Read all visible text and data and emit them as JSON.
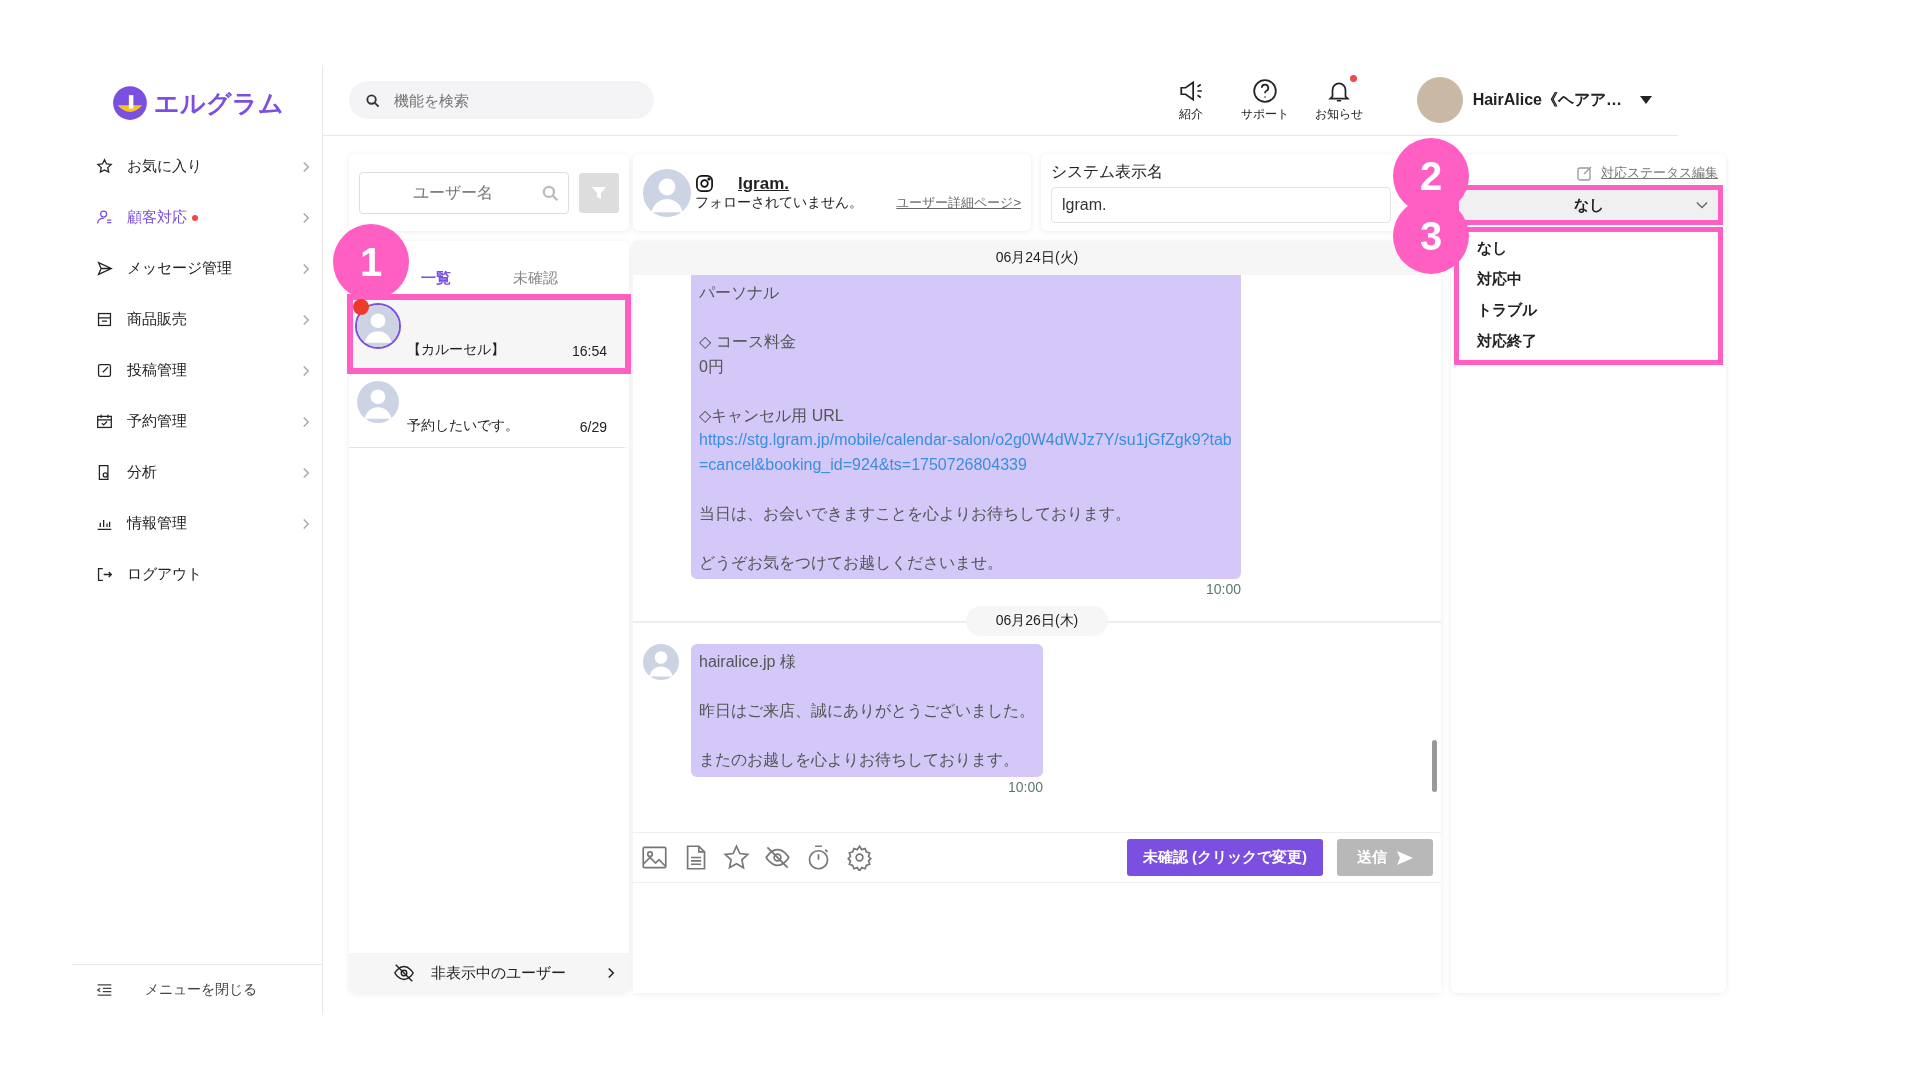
{
  "logo": {
    "text": "エルグラム"
  },
  "sidebar": {
    "items": [
      {
        "label": "お気に入り",
        "selected": false,
        "notification": false,
        "has_submenu": true
      },
      {
        "label": "顧客対応",
        "selected": true,
        "notification": true,
        "has_submenu": true
      },
      {
        "label": "メッセージ管理",
        "selected": false,
        "notification": false,
        "has_submenu": true
      },
      {
        "label": "商品販売",
        "selected": false,
        "notification": false,
        "has_submenu": true
      },
      {
        "label": "投稿管理",
        "selected": false,
        "notification": false,
        "has_submenu": true
      },
      {
        "label": "予約管理",
        "selected": false,
        "notification": false,
        "has_submenu": true
      },
      {
        "label": "分析",
        "selected": false,
        "notification": false,
        "has_submenu": true
      },
      {
        "label": "情報管理",
        "selected": false,
        "notification": false,
        "has_submenu": true
      },
      {
        "label": "ログアウト",
        "selected": false,
        "notification": false,
        "has_submenu": false
      }
    ],
    "collapse_label": "メニューを閉じる"
  },
  "header": {
    "search": {
      "placeholder": "機能を検索"
    },
    "nav": [
      {
        "label": "紹介",
        "notification": false
      },
      {
        "label": "サポート",
        "notification": false
      },
      {
        "label": "お知らせ",
        "notification": true
      }
    ],
    "user": {
      "name": "HairAlice《ヘアア…"
    }
  },
  "user_list": {
    "search": {
      "placeholder": "ユーザー名"
    },
    "tabs": [
      {
        "label": "一覧",
        "selected": true
      },
      {
        "label": "未確認",
        "selected": false
      }
    ],
    "conversations": [
      {
        "preview": "【カルーセル】",
        "time": "16:54",
        "unread": true,
        "selected": true,
        "annotation": "1"
      },
      {
        "preview": "予約したいです。",
        "time": "6/29",
        "unread": false,
        "selected": false
      }
    ],
    "hidden_users_label": "非表示中のユーザー"
  },
  "chat_header": {
    "username": "lgram.",
    "follow_status": "フォローされていません。",
    "detail_link": "ユーザー詳細ページ>"
  },
  "system_name": {
    "label": "システム表示名",
    "value": "lgram."
  },
  "status": {
    "edit_link": "対応ステータス編集",
    "value": "なし",
    "select_annotation": "2",
    "options": [
      "なし",
      "対応中",
      "トラブル",
      "対応終了"
    ],
    "menu_annotation": "3"
  },
  "chat": {
    "pinned_date": "06月24日(火)",
    "items": [
      {
        "kind": "message",
        "avatar": false,
        "paragraphs": [
          {
            "lines": [
              "パーソナル"
            ]
          },
          {
            "lines": [
              "◇ コース料金",
              "0円"
            ]
          },
          {
            "lines": [
              "◇キャンセル用 URL"
            ],
            "link": "https://stg.lgram.jp/mobile/calendar-salon/o2g0W4dWJz7Y/su1jGfZgk9?tab=cancel&booking_id=924&ts=1750726804339"
          },
          {
            "lines": [
              "当日は、お会いできますことを心よりお待ちしております。"
            ]
          },
          {
            "lines": [
              "どうぞお気をつけてお越しくださいませ。"
            ]
          }
        ],
        "time": "10:00"
      },
      {
        "kind": "date",
        "text": "06月26日(木)"
      },
      {
        "kind": "message",
        "avatar": true,
        "paragraphs": [
          {
            "lines": [
              "hairalice.jp 様"
            ]
          },
          {
            "lines": [
              "昨日はご来店、誠にありがとうございました。"
            ]
          },
          {
            "lines": [
              "またのお越しを心よりお待ちしております。"
            ]
          }
        ],
        "time": "10:00"
      }
    ]
  },
  "composer": {
    "status_button": "未確認 (クリックで変更)",
    "send_button": {
      "label": "送信",
      "disabled": true
    }
  }
}
